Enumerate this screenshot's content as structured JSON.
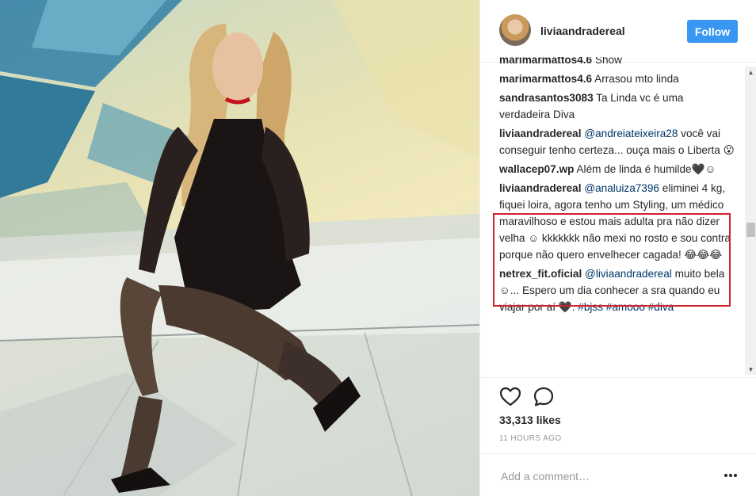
{
  "post": {
    "author": "liviaandradereal",
    "follow_label": "Follow",
    "likes": "33,313 likes",
    "timestamp": "11 HOURS AGO",
    "comment_placeholder": "Add a comment…"
  },
  "comments": [
    {
      "user": "marimarmattos4.6",
      "parts": [
        {
          "type": "text",
          "value": "Show"
        }
      ]
    },
    {
      "user": "marimarmattos4.6",
      "parts": [
        {
          "type": "text",
          "value": "Arrasou mto linda"
        }
      ]
    },
    {
      "user": "sandrasantos3083",
      "parts": [
        {
          "type": "text",
          "value": "Ta Linda vc é uma verdadeira Diva"
        }
      ]
    },
    {
      "user": "liviaandradereal",
      "parts": [
        {
          "type": "mention",
          "value": "@andreiateixeira28"
        },
        {
          "type": "text",
          "value": " você vai conseguir tenho certeza... ouça mais o Liberta 😮"
        }
      ]
    },
    {
      "user": "wallacep07.wp",
      "parts": [
        {
          "type": "text",
          "value": "Além de linda é humilde🖤☺"
        }
      ]
    },
    {
      "user": "liviaandradereal",
      "highlighted": true,
      "parts": [
        {
          "type": "mention",
          "value": "@analuiza7396"
        },
        {
          "type": "text",
          "value": " eliminei 4 kg, fiquei loira, agora tenho um Styling, um médico maravilhoso e estou mais adulta pra não dizer velha ☺ kkkkkkk não mexi no rosto e sou contra porque não quero envelhecer cagada! 😂😂😂"
        }
      ]
    },
    {
      "user": "netrex_fit.oficial",
      "parts": [
        {
          "type": "mention",
          "value": "@liviaandradereal"
        },
        {
          "type": "text",
          "value": " muito bela ☺... Espero um dia conhecer a sra quando eu viajar por aí 🖤. "
        },
        {
          "type": "tag",
          "value": "#bjss"
        },
        {
          "type": "text",
          "value": " "
        },
        {
          "type": "tag",
          "value": "#amooo"
        },
        {
          "type": "text",
          "value": " "
        },
        {
          "type": "tag",
          "value": "#diva"
        }
      ]
    }
  ],
  "icons": {
    "like": "heart-icon",
    "comment": "speech-bubble-icon",
    "more": "ellipsis-icon"
  },
  "colors": {
    "follow_button": "#3897f0",
    "highlight_border": "#d0222c",
    "link": "#003569"
  }
}
